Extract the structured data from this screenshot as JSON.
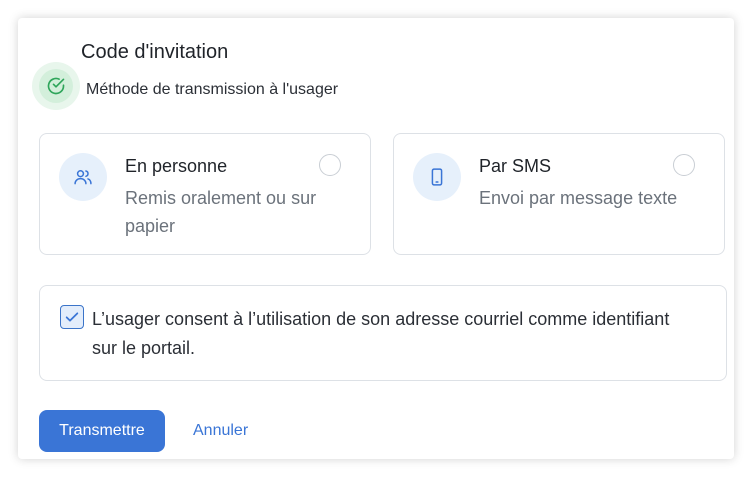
{
  "dialog": {
    "title": "Code d'invitation",
    "subtitle": "Méthode de transmission à l'usager",
    "status_icon": "check-circle-icon"
  },
  "options": [
    {
      "title": "En personne",
      "description": "Remis oralement ou sur papier",
      "icon": "users-icon",
      "selected": false
    },
    {
      "title": "Par SMS",
      "description": "Envoi par message texte",
      "icon": "smartphone-icon",
      "selected": false
    }
  ],
  "consent": {
    "checked": true,
    "text": "L’usager consent à l’utilisation de son adresse courriel comme identifiant sur le portail."
  },
  "actions": {
    "submit_label": "Transmettre",
    "cancel_label": "Annuler"
  },
  "colors": {
    "accent": "#3a75d6",
    "success": "#2ea55a",
    "border": "#dde1e6"
  }
}
